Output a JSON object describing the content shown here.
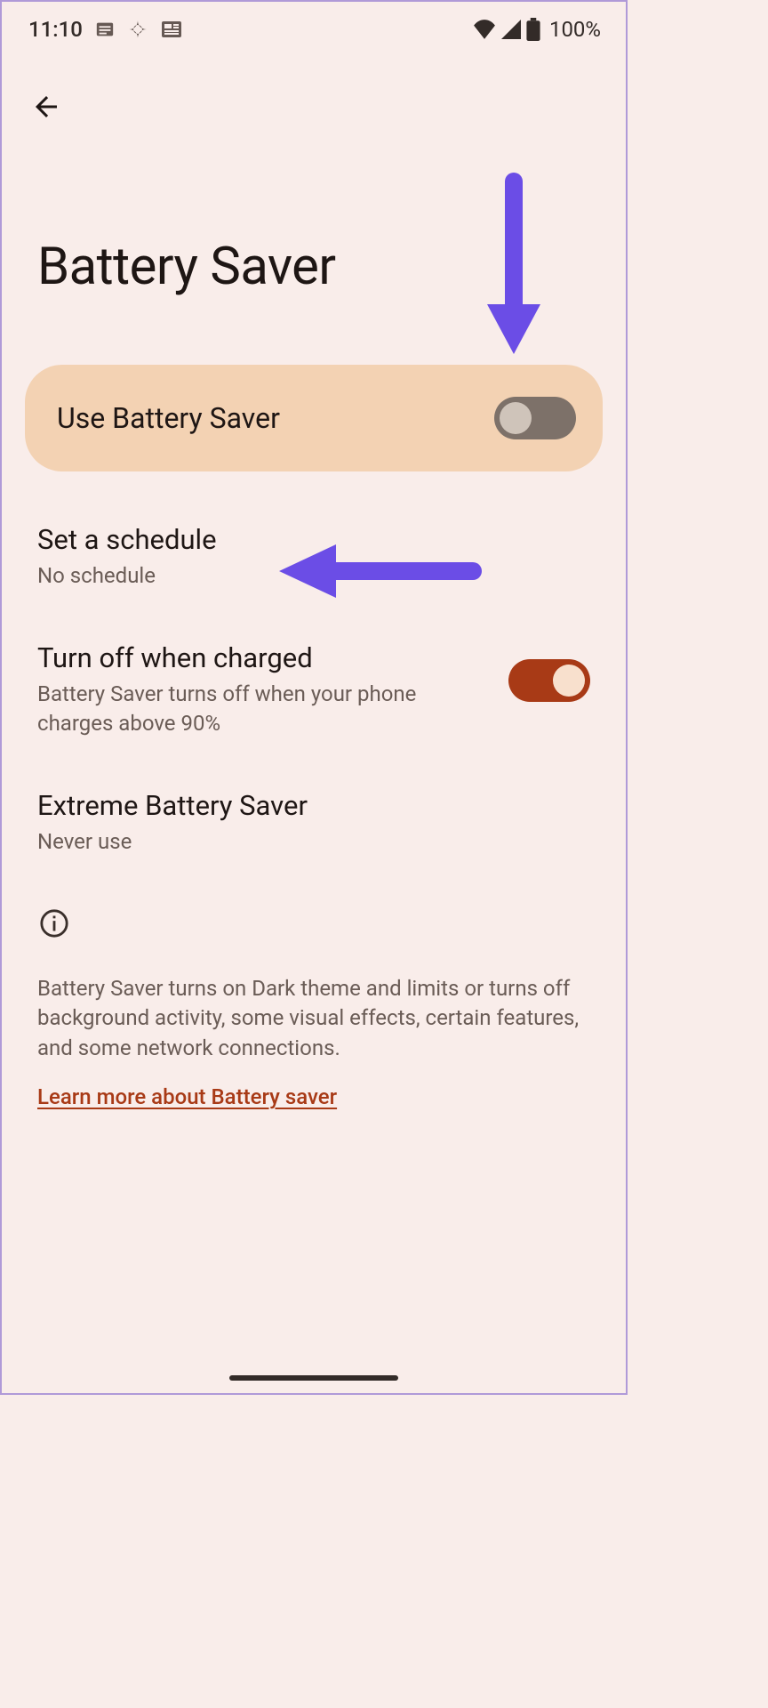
{
  "statusBar": {
    "time": "11:10",
    "batteryPercent": "100%"
  },
  "page": {
    "title": "Battery Saver"
  },
  "mainToggle": {
    "label": "Use Battery Saver",
    "enabled": false
  },
  "settings": {
    "schedule": {
      "title": "Set a schedule",
      "sub": "No schedule"
    },
    "turnOff": {
      "title": "Turn off when charged",
      "sub": "Battery Saver turns off when your phone charges above 90%",
      "enabled": true
    },
    "extreme": {
      "title": "Extreme Battery Saver",
      "sub": "Never use"
    }
  },
  "info": {
    "text": "Battery Saver turns on Dark theme and limits or turns off background activity, some visual effects, certain features, and some network connections.",
    "learnMore": "Learn more about Battery saver"
  },
  "annotation": {
    "arrowColor": "#6b4de6"
  }
}
